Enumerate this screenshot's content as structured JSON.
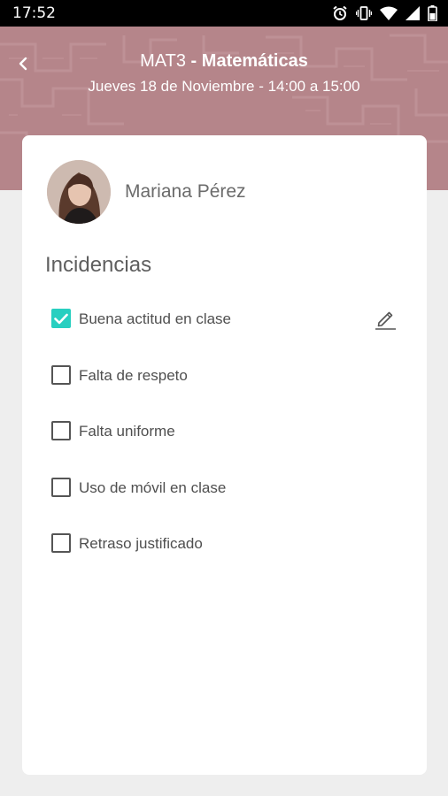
{
  "status_bar": {
    "time": "17:52",
    "icons": [
      "alarm-icon",
      "vibrate-icon",
      "wifi-icon",
      "signal-icon",
      "battery-icon"
    ]
  },
  "header": {
    "course_code": "MAT3",
    "separator": " - ",
    "subject": "Matemáticas",
    "schedule": "Jueves 18 de Noviembre - 14:00 a 15:00",
    "background_color": "#b5858a"
  },
  "student": {
    "name": "Mariana Pérez"
  },
  "incidents": {
    "title": "Incidencias",
    "accent_color": "#28cfc0",
    "items": [
      {
        "label": "Buena actitud en clase",
        "checked": true,
        "editable": true
      },
      {
        "label": "Falta de respeto",
        "checked": false
      },
      {
        "label": "Falta uniforme",
        "checked": false
      },
      {
        "label": "Uso de móvil en clase",
        "checked": false
      },
      {
        "label": "Retraso justificado",
        "checked": false
      }
    ]
  }
}
